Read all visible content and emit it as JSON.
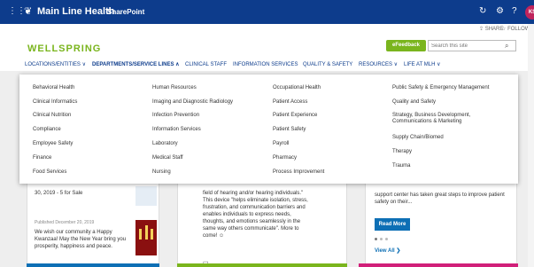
{
  "suitebar": {
    "brand": "Main Line Health",
    "app": "SharePoint",
    "avatar": "KS",
    "icons": [
      "app-launcher-icon",
      "refresh-icon",
      "settings-icon",
      "help-icon"
    ]
  },
  "pagebar": {
    "share": "SHARE",
    "follow": "FOLLOW"
  },
  "header": {
    "site": "WELLSPRING",
    "feedback": "eFeedback",
    "search_placeholder": "Search this site"
  },
  "topnav": [
    {
      "label": "LOCATIONS/ENTITIES ∨"
    },
    {
      "label": "DEPARTMENTS/SERVICE LINES ∧"
    },
    {
      "label": "CLINICAL STAFF"
    },
    {
      "label": "INFORMATION SERVICES"
    },
    {
      "label": "QUALITY & SAFETY"
    },
    {
      "label": "RESOURCES ∨"
    },
    {
      "label": "LIFE AT MLH ∨"
    }
  ],
  "mega_menu": {
    "col1": [
      "Behavioral Health",
      "Clinical Informatics",
      "Clinical Nutrition",
      "Compliance",
      "Employee Safety",
      "Finance",
      "Food Services"
    ],
    "col2": [
      "Human Resources",
      "Imaging and Diagnostic Radiology",
      "Infection Prevention",
      "Information Services",
      "Laboratory",
      "Medical Staff",
      "Nursing"
    ],
    "col3": [
      "Occupational Health",
      "Patient Access",
      "Patient Experience",
      "Patient Safety",
      "Payroll",
      "Pharmacy",
      "Process Improvement"
    ],
    "col4": [
      "Public Safety & Emergency Management",
      "Quality and Safety",
      "Strategy, Business Development, Communications & Marketing",
      "Supply Chain/Biomed",
      "Therapy",
      "Trauma"
    ]
  },
  "cards": {
    "left_top": "30, 2019 - 5 for Sale",
    "left_meta": "Published December 20, 2019",
    "left_body": "We wish our community a Happy Kwanzaa! May the New Year bring you prosperity, happiness and peace.",
    "mid_body": "field of hearing and/or hearing individuals.\" This device \"helps eliminate isolation, stress, frustration, and communication barriers and enables individuals to express needs, thoughts, and emotions seamlessly in the same way others communicate\". More to come! ☺",
    "right_body": "support center has taken great steps to improve patient safety on their...",
    "read_more": "Read More",
    "view_all": "View All ❯"
  },
  "colors": {
    "suitebar": "#0d3c8c",
    "accent_green": "#7ab51d",
    "link_blue": "#0d6fb5"
  }
}
